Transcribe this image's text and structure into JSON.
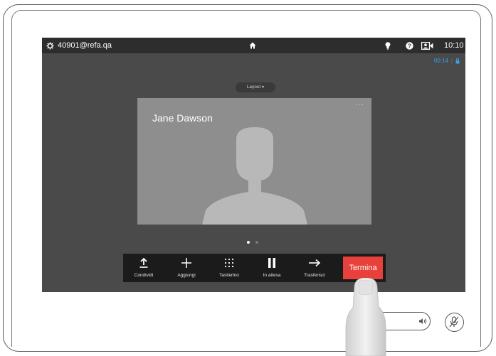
{
  "topbar": {
    "account": "40901@refa.qa",
    "time": "10:10",
    "icons": [
      "gear-icon",
      "home-icon",
      "lightbulb-icon",
      "help-icon",
      "camera-icon"
    ]
  },
  "call": {
    "duration": "00:14",
    "layout_label": "Layout",
    "participant_name": "Jane Dawson",
    "more_label": "···"
  },
  "callbar": {
    "share_label": "Condividi",
    "add_label": "Aggiungi",
    "keypad_label": "Tastierino",
    "hold_label": "In attesa",
    "transfer_label": "Trasferisci",
    "end_label": "Termina"
  },
  "colors": {
    "end_call": "#e8403a",
    "timer": "#3aa0e8",
    "screen_bg": "#4a4a4a",
    "video_bg": "#8e8e8e"
  }
}
